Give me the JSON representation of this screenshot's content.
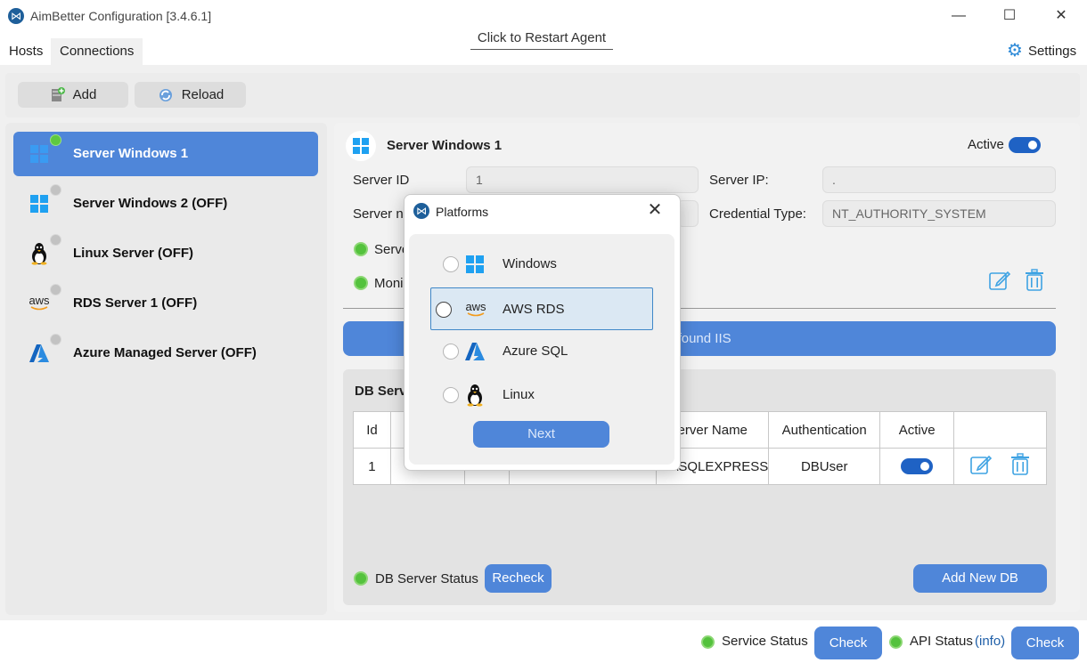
{
  "window": {
    "title": "AimBetter Configuration [3.4.6.1]",
    "minimize": "—",
    "maximize": "☐",
    "close": "✕"
  },
  "menu": {
    "tabs": [
      {
        "label": "Hosts"
      },
      {
        "label": "Connections"
      }
    ],
    "restart_label": "Click to Restart Agent",
    "settings_label": "Settings"
  },
  "toolbar": {
    "add_label": "Add",
    "reload_label": "Reload"
  },
  "hosts": [
    {
      "label": "Server Windows 1",
      "platform": "windows",
      "selected": true,
      "online": true
    },
    {
      "label": "Server Windows 2 (OFF)",
      "platform": "windows",
      "selected": false,
      "online": false
    },
    {
      "label": "Linux Server (OFF)",
      "platform": "linux",
      "selected": false,
      "online": false
    },
    {
      "label": "RDS Server 1 (OFF)",
      "platform": "aws",
      "selected": false,
      "online": false
    },
    {
      "label": "Azure Managed Server (OFF)",
      "platform": "azure",
      "selected": false,
      "online": false
    }
  ],
  "server": {
    "title": "Server Windows 1",
    "active_label": "Active",
    "id_label": "Server ID",
    "id_value": "1",
    "name_label": "Server na",
    "ip_label": "Server IP:",
    "ip_value": ".",
    "cred_label": "Credential Type:",
    "cred_value": "NT_AUTHORITY_SYSTEM",
    "service_label": "Serve",
    "monitor_label": "Moni",
    "iis_text": "'t found IIS"
  },
  "db": {
    "title": "DB Serv",
    "columns": [
      "Id",
      "",
      "",
      "",
      "erver Name",
      "Authentication",
      "Active",
      ""
    ],
    "rows": [
      {
        "id": "1",
        "server_name": "\\SQLEXPRESS",
        "authentication": "DBUser"
      }
    ],
    "status_label": "DB Server Status",
    "recheck_label": "Recheck",
    "add_label": "Add New DB"
  },
  "statusbar": {
    "service_label": "Service Status",
    "check_label": "Check",
    "api_label": "API Status",
    "info_label": "(info)",
    "check2_label": "Check"
  },
  "modal": {
    "title": "Platforms",
    "close": "✕",
    "options": [
      {
        "label": "Windows",
        "icon": "windows-icon",
        "selected": false
      },
      {
        "label": "AWS RDS",
        "icon": "aws-icon",
        "selected": true
      },
      {
        "label": "Azure SQL",
        "icon": "azure-icon",
        "selected": false
      },
      {
        "label": "Linux",
        "icon": "linux-icon",
        "selected": false
      }
    ],
    "next_label": "Next",
    "aws_mark": "aws"
  },
  "colors": {
    "accent": "#4f86d9",
    "toggle": "#1f62c4",
    "online": "#54c23d",
    "offline": "#c2c2c2"
  }
}
